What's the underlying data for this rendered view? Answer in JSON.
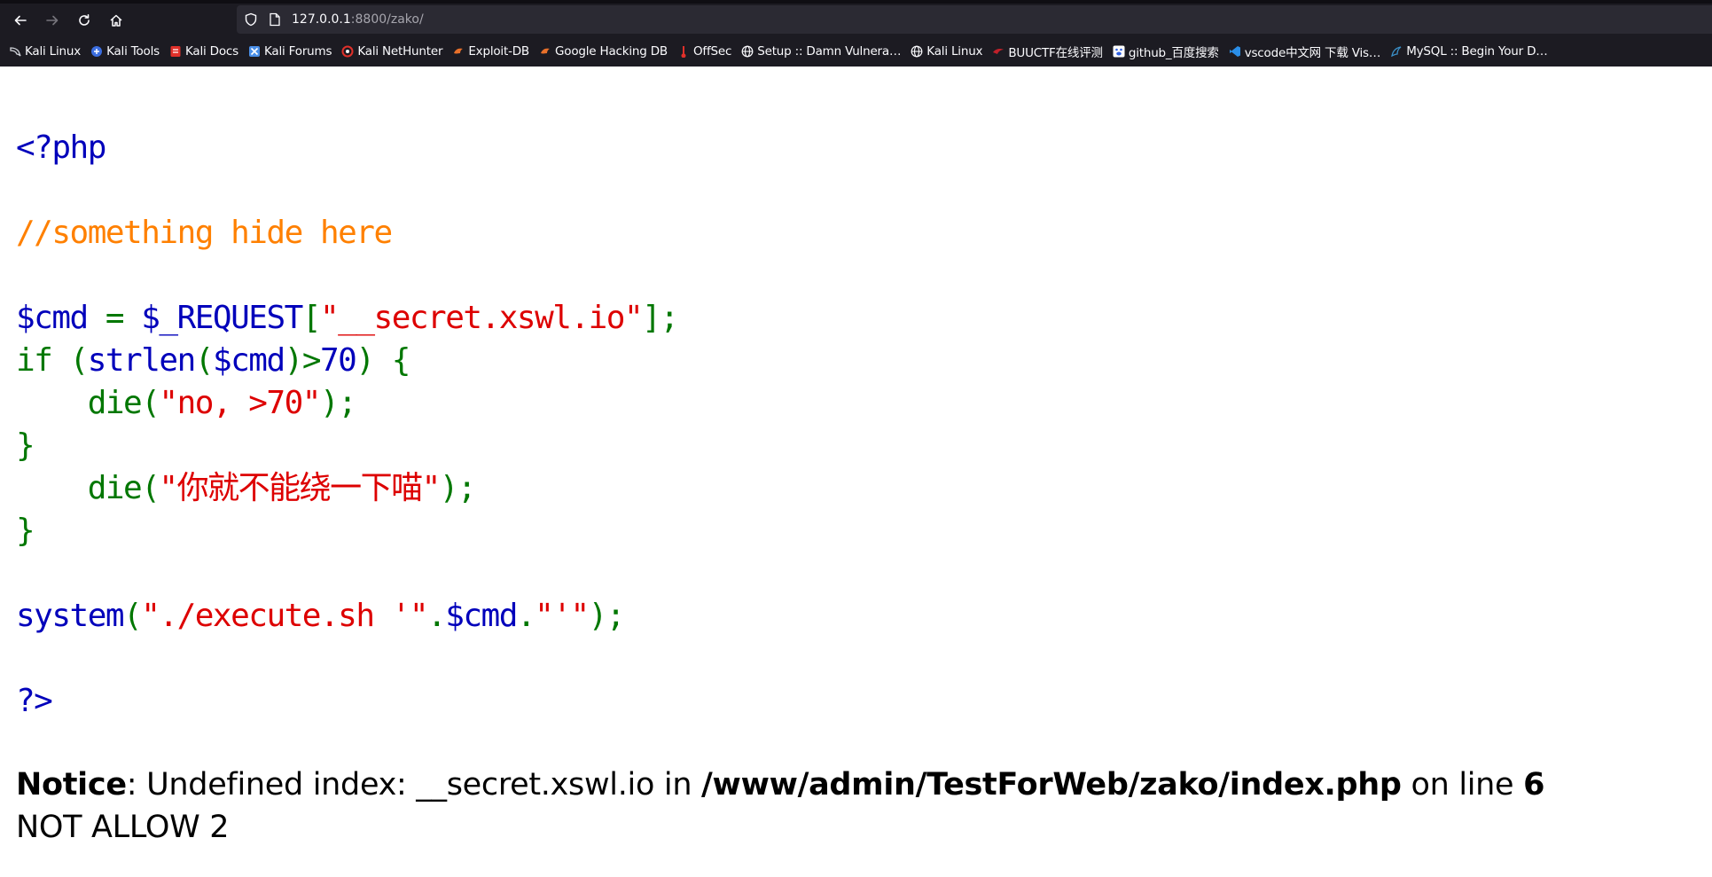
{
  "browser": {
    "url_host": "127.0.0.1",
    "url_rest": ":8800/zako/",
    "buttons": {
      "back": "back-arrow",
      "forward": "forward-arrow",
      "reload": "reload",
      "home": "home"
    },
    "bookmarks": [
      {
        "label": "Kali Linux",
        "icon": "kali-dragon-icon",
        "color": "#cfd2d8"
      },
      {
        "label": "Kali Tools",
        "icon": "kali-tools-icon",
        "color": "#3c6ee0"
      },
      {
        "label": "Kali Docs",
        "icon": "kali-docs-icon",
        "color": "#e0302a"
      },
      {
        "label": "Kali Forums",
        "icon": "kali-forums-icon",
        "color": "#4a8fe8"
      },
      {
        "label": "Kali NetHunter",
        "icon": "nethunter-icon",
        "color": "#e0302a"
      },
      {
        "label": "Exploit-DB",
        "icon": "exploit-db-icon",
        "color": "#e8702a"
      },
      {
        "label": "Google Hacking DB",
        "icon": "ghdb-icon",
        "color": "#e8702a"
      },
      {
        "label": "OffSec",
        "icon": "offsec-icon",
        "color": "#e0302a"
      },
      {
        "label": "Setup :: Damn Vulnera…",
        "icon": "globe-icon",
        "color": "#fbfbfe"
      },
      {
        "label": "Kali Linux",
        "icon": "globe-icon",
        "color": "#fbfbfe"
      },
      {
        "label": "BUUCTF在线评测",
        "icon": "buuctf-icon",
        "color": "#c0202a"
      },
      {
        "label": "github_百度搜索",
        "icon": "baidu-paw-icon",
        "color": "#3060e0"
      },
      {
        "label": "vscode中文网 下载 Vis…",
        "icon": "vscode-icon",
        "color": "#2a8ee8"
      },
      {
        "label": "MySQL :: Begin Your D…",
        "icon": "mysql-dolphin-icon",
        "color": "#3a8fc8"
      }
    ]
  },
  "code": {
    "open_tag": "<?php",
    "comment": "//something hide here",
    "l3_var": "$cmd",
    "l3_eq": " = ",
    "l3_req": "$_REQUEST",
    "l3_open": "[",
    "l3_key": "\"__secret.xswl.io\"",
    "l3_close": "];",
    "l4_if": "if (",
    "l4_fn": "strlen",
    "l4_p1": "(",
    "l4_var": "$cmd",
    "l4_p2": ")>",
    "l4_num": "70",
    "l4_end": ") {",
    "l5_die": "    die(",
    "l5_str": "\"no, >70\"",
    "l5_end": ");",
    "l6_brace": "}",
    "l7_die": "    die(",
    "l7_str": "\"你就不能绕一下喵\"",
    "l7_end": ");",
    "l8_brace": "}",
    "l9_fn": "system",
    "l9_p": "(",
    "l9_s1": "\"./execute.sh '\"",
    "l9_dot1": ".",
    "l9_var": "$cmd",
    "l9_dot2": ".",
    "l9_s2": "\"'\"",
    "l9_end": ");",
    "close_tag": "?>"
  },
  "notice": {
    "label": "Notice",
    "text1": ": Undefined index: __secret.xswl.io in ",
    "path": "/www/admin/TestForWeb/zako/index.php",
    "text2": " on line ",
    "line": "6",
    "output": "NOT ALLOW 2"
  }
}
